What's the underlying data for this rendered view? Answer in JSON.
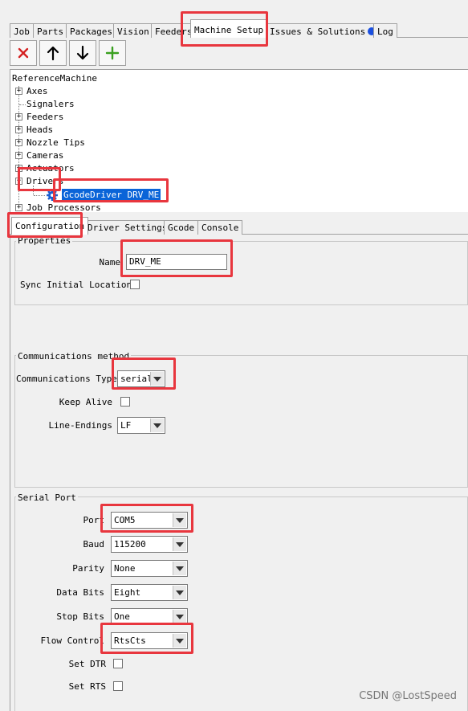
{
  "main_tabs": [
    {
      "label": "Job"
    },
    {
      "label": "Parts"
    },
    {
      "label": "Packages"
    },
    {
      "label": "Vision"
    },
    {
      "label": "Feeders"
    },
    {
      "label": "Machine Setup"
    },
    {
      "label": "Issues & Solutions"
    },
    {
      "label": "Log"
    }
  ],
  "toolbar": {
    "delete": {
      "glyph": "✕",
      "color": "#d42020"
    },
    "up": {
      "glyph": "↑"
    },
    "down": {
      "glyph": "↓"
    },
    "add": {
      "glyph": "+",
      "color": "#3aa020"
    }
  },
  "tree": {
    "root": "ReferenceMachine",
    "items": [
      {
        "label": "Axes",
        "expander": "+"
      },
      {
        "label": "Signalers",
        "expander": ""
      },
      {
        "label": "Feeders",
        "expander": "+"
      },
      {
        "label": "Heads",
        "expander": "+"
      },
      {
        "label": "Nozzle Tips",
        "expander": "+"
      },
      {
        "label": "Cameras",
        "expander": "+"
      },
      {
        "label": "Actuators",
        "expander": "+"
      },
      {
        "label": "Drivers",
        "expander": "−"
      },
      {
        "label": "GcodeDriver DRV_ME",
        "expander": ""
      },
      {
        "label": "Job Processors",
        "expander": "+"
      }
    ]
  },
  "sub_tabs": [
    {
      "label": "Configuration"
    },
    {
      "label": "Driver Settings"
    },
    {
      "label": "Gcode"
    },
    {
      "label": "Console"
    }
  ],
  "properties": {
    "title": "Properties",
    "name_label": "Name",
    "name_value": "DRV_ME",
    "sync_label": "Sync Initial Location"
  },
  "communications": {
    "title": "Communications method",
    "type_label": "Communications Type",
    "type_value": "serial",
    "keep_alive_label": "Keep Alive",
    "line_endings_label": "Line-Endings",
    "line_endings_value": "LF"
  },
  "serial_port": {
    "title": "Serial Port",
    "port_label": "Port",
    "port_value": "COM5",
    "baud_label": "Baud",
    "baud_value": "115200",
    "parity_label": "Parity",
    "parity_value": "None",
    "data_bits_label": "Data Bits",
    "data_bits_value": "Eight",
    "stop_bits_label": "Stop Bits",
    "stop_bits_value": "One",
    "flow_label": "Flow Control",
    "flow_value": "RtsCts",
    "dtr_label": "Set DTR",
    "rts_label": "Set RTS"
  },
  "watermark": "CSDN @LostSpeed"
}
